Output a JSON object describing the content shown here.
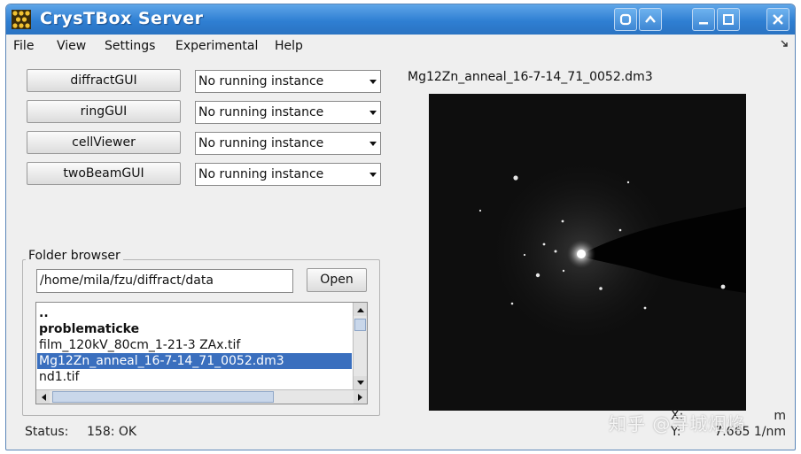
{
  "window": {
    "title": "CrysTBox Server",
    "title_icon": "crystal-lattice-icon",
    "title_buttons": [
      "restore-icon",
      "shade-icon",
      "minimize-icon",
      "maximize-icon",
      "close-icon"
    ]
  },
  "menu": {
    "items": [
      "File",
      "View",
      "Settings",
      "Experimental",
      "Help"
    ],
    "corner_arrow": "arrow-icon"
  },
  "tools": [
    {
      "label": "diffractGUI",
      "instance": "No running instance"
    },
    {
      "label": "ringGUI",
      "instance": "No running instance"
    },
    {
      "label": "cellViewer",
      "instance": "No running instance"
    },
    {
      "label": "twoBeamGUI",
      "instance": "No running instance"
    }
  ],
  "folder_browser": {
    "legend": "Folder browser",
    "path": "/home/mila/fzu/diffract/data",
    "open_label": "Open",
    "files": [
      {
        "name": "..",
        "bold": true,
        "selected": false
      },
      {
        "name": "problematicke",
        "bold": true,
        "selected": false
      },
      {
        "name": "film_120kV_80cm_1-21-3 ZAx.tif",
        "bold": false,
        "selected": false
      },
      {
        "name": "Mg12Zn_anneal_16-7-14_71_0052.dm3",
        "bold": false,
        "selected": true
      },
      {
        "name": "nd1.tif",
        "bold": false,
        "selected": false
      }
    ]
  },
  "status": {
    "label": "Status:",
    "value": "158: OK"
  },
  "preview": {
    "filename": "Mg12Zn_anneal_16-7-14_71_0052.dm3",
    "x_label": "X:",
    "y_label": "Y:",
    "x_unit": "m",
    "y_value": "7.665 1/nm"
  },
  "watermark": "知乎 @寻城烟焰",
  "colors": {
    "title_bar": "#2f7fd3",
    "selection": "#3a6fbe",
    "window_bg": "#efefef"
  }
}
